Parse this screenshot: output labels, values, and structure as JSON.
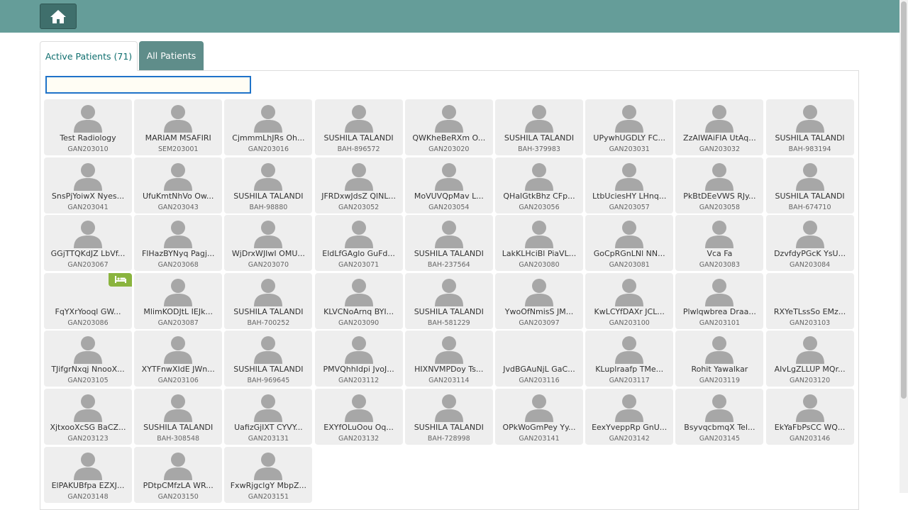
{
  "header": {
    "home_icon": "home-icon",
    "bar_color": "#659d99"
  },
  "tabs": [
    {
      "label": "Active Patients (71)",
      "active": true
    },
    {
      "label": "All Patients",
      "active": false
    }
  ],
  "search": {
    "value": "",
    "placeholder": ""
  },
  "patients": [
    {
      "name": "Test Radiology",
      "id": "GAN203010"
    },
    {
      "name": "MARIAM MSAFIRI",
      "id": "SEM203001"
    },
    {
      "name": "CjmmmLhJRs Oh...",
      "id": "GAN203016"
    },
    {
      "name": "SUSHILA TALANDI",
      "id": "BAH-896572"
    },
    {
      "name": "QWKheBeRXm O...",
      "id": "GAN203020"
    },
    {
      "name": "SUSHILA TALANDI",
      "id": "BAH-379983"
    },
    {
      "name": "UPywhUGDLY FC...",
      "id": "GAN203031"
    },
    {
      "name": "ZzAIWAiFIA UtAq...",
      "id": "GAN203032"
    },
    {
      "name": "SUSHILA TALANDI",
      "id": "BAH-983194"
    },
    {
      "name": "SnsPjYoiwX Nyes...",
      "id": "GAN203041"
    },
    {
      "name": "UfuKmtNhVo Ow...",
      "id": "GAN203043"
    },
    {
      "name": "SUSHILA TALANDI",
      "id": "BAH-98880"
    },
    {
      "name": "JFRDxwJdsZ QlNL...",
      "id": "GAN203052"
    },
    {
      "name": "MoVUVQpMav L...",
      "id": "GAN203054"
    },
    {
      "name": "QHalGtkBhz CFp...",
      "id": "GAN203056"
    },
    {
      "name": "LtbUciesHY LHnq...",
      "id": "GAN203057"
    },
    {
      "name": "PkBtDEeVWS RJy...",
      "id": "GAN203058"
    },
    {
      "name": "SUSHILA TALANDI",
      "id": "BAH-674710"
    },
    {
      "name": "GGjTTQKdJZ LbVf...",
      "id": "GAN203067"
    },
    {
      "name": "FlHazBYNyq Pagj...",
      "id": "GAN203068"
    },
    {
      "name": "WjDrxWJIwI OMU...",
      "id": "GAN203070"
    },
    {
      "name": "EldLfGAglo GuFd...",
      "id": "GAN203071"
    },
    {
      "name": "SUSHILA TALANDI",
      "id": "BAH-237564"
    },
    {
      "name": "LakKLHciBl PiaVL...",
      "id": "GAN203080"
    },
    {
      "name": "GoCpRGnLNl NN...",
      "id": "GAN203081"
    },
    {
      "name": "Vca Fa",
      "id": "GAN203083"
    },
    {
      "name": "DzvfdyPGcK YsU...",
      "id": "GAN203084"
    },
    {
      "name": "FqYXrYooql GW...",
      "id": "GAN203086",
      "bed": true,
      "no_avatar": true
    },
    {
      "name": "MlimKODJtL IEJk...",
      "id": "GAN203087"
    },
    {
      "name": "SUSHILA TALANDI",
      "id": "BAH-700252"
    },
    {
      "name": "KLVCNoArnq BYI...",
      "id": "GAN203090"
    },
    {
      "name": "SUSHILA TALANDI",
      "id": "BAH-581229"
    },
    {
      "name": "YwoOfNmisS JM...",
      "id": "GAN203097"
    },
    {
      "name": "KwLCYfDAXr JCL...",
      "id": "GAN203100"
    },
    {
      "name": "Plwlqwbrea Draa...",
      "id": "GAN203101"
    },
    {
      "name": "RXYeTLssSo EMz...",
      "id": "GAN203103",
      "no_avatar": true
    },
    {
      "name": "TJifgrNxqj NnooX...",
      "id": "GAN203105"
    },
    {
      "name": "XYTFnwXIdE JWn...",
      "id": "GAN203106"
    },
    {
      "name": "SUSHILA TALANDI",
      "id": "BAH-969645"
    },
    {
      "name": "PMVQhhIdpi JvoJ...",
      "id": "GAN203112"
    },
    {
      "name": "HIXNVMPDoy Ts...",
      "id": "GAN203114"
    },
    {
      "name": "JvdBGAuNjL GaC...",
      "id": "GAN203116",
      "no_avatar": true
    },
    {
      "name": "KLuplraafp TMe...",
      "id": "GAN203117"
    },
    {
      "name": "Rohit Yawalkar",
      "id": "GAN203119"
    },
    {
      "name": "AIvLgZLLUP MQr...",
      "id": "GAN203120"
    },
    {
      "name": "XjtxooXcSG BaCZ...",
      "id": "GAN203123"
    },
    {
      "name": "SUSHILA TALANDI",
      "id": "BAH-308548"
    },
    {
      "name": "UafizGjIXT CYVY...",
      "id": "GAN203131"
    },
    {
      "name": "EXYfOLuOou Oq...",
      "id": "GAN203132"
    },
    {
      "name": "SUSHILA TALANDI",
      "id": "BAH-728998"
    },
    {
      "name": "OPkWoGmPey Yy...",
      "id": "GAN203141"
    },
    {
      "name": "EexYveppRp GnU...",
      "id": "GAN203142"
    },
    {
      "name": "BsyvqcbmqX Tel...",
      "id": "GAN203145"
    },
    {
      "name": "EkYaFbPsCC WQ...",
      "id": "GAN203146"
    },
    {
      "name": "ElPAKUBfpa EZXJ...",
      "id": "GAN203148"
    },
    {
      "name": "PDtpCMfzLA WR...",
      "id": "GAN203150"
    },
    {
      "name": "FxwRjgclgY MbpZ...",
      "id": "GAN203151"
    }
  ]
}
